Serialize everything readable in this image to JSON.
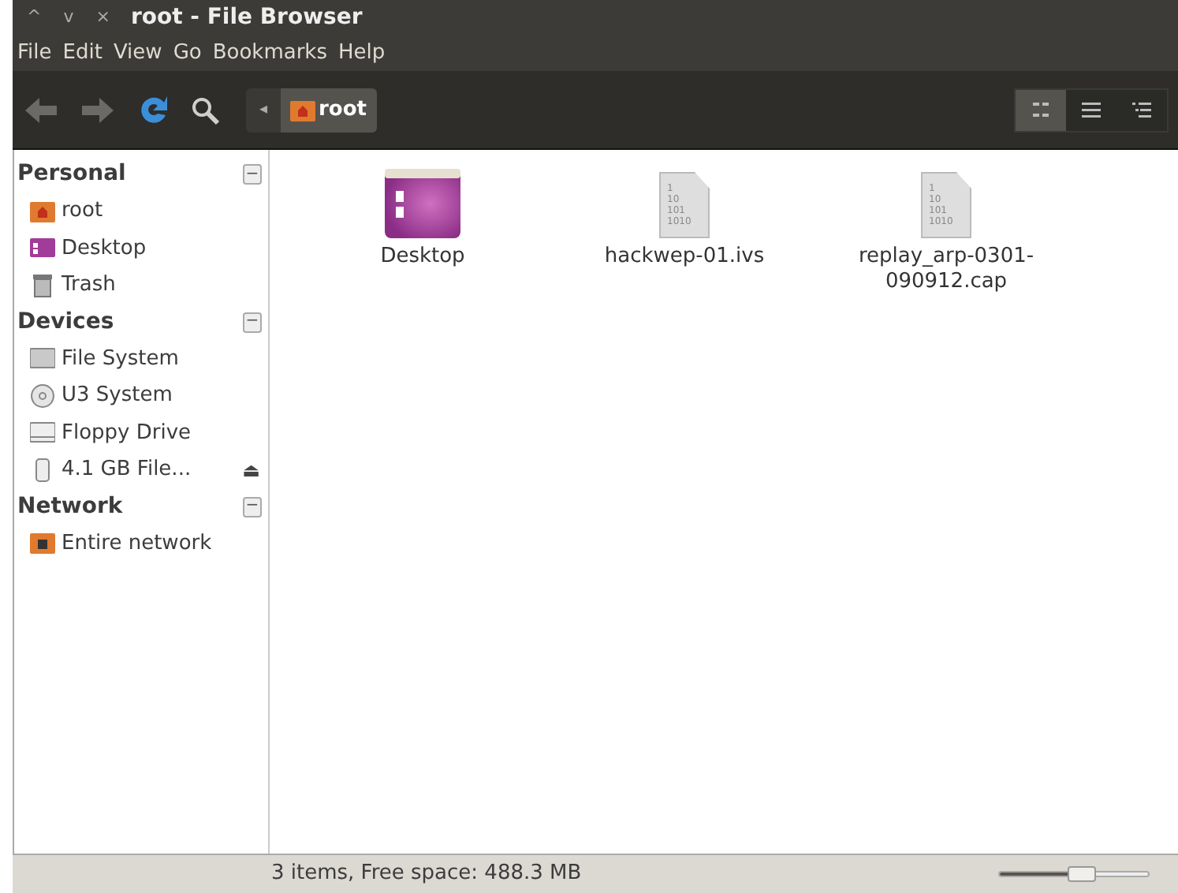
{
  "window": {
    "title": "root - File Browser",
    "controls": [
      "^",
      "v",
      "×"
    ]
  },
  "menu": [
    "File",
    "Edit",
    "View",
    "Go",
    "Bookmarks",
    "Help"
  ],
  "toolbar": {
    "tools": [
      {
        "kind": "back",
        "disabled": true
      },
      {
        "kind": "forward",
        "disabled": true
      },
      {
        "kind": "reload",
        "disabled": false
      },
      {
        "kind": "search",
        "disabled": false
      }
    ],
    "path_arrow": "◂",
    "path": "root",
    "views": [
      {
        "kind": "icons",
        "selected": true
      },
      {
        "kind": "list",
        "selected": false
      },
      {
        "kind": "compact",
        "selected": false
      }
    ]
  },
  "sidebar": [
    {
      "title": "Personal",
      "collapse": "−",
      "items": [
        {
          "kind": "home",
          "label": "root"
        },
        {
          "kind": "desktop",
          "label": "Desktop"
        },
        {
          "kind": "trash",
          "label": "Trash"
        }
      ]
    },
    {
      "title": "Devices",
      "collapse": "−",
      "items": [
        {
          "kind": "disk",
          "label": "File System"
        },
        {
          "kind": "cd",
          "label": "U3 System"
        },
        {
          "kind": "floppy",
          "label": "Floppy Drive"
        },
        {
          "kind": "usb",
          "label": "4.1 GB File...",
          "eject": "⏏"
        }
      ]
    },
    {
      "title": "Network",
      "collapse": "−",
      "items": [
        {
          "kind": "network",
          "label": "Entire network"
        }
      ]
    }
  ],
  "files": [
    {
      "kind": "folder",
      "name": "Desktop"
    },
    {
      "kind": "binary",
      "name": "hackwep-01.ivs",
      "icon_lines": [
        "1",
        "10",
        "101",
        "1010"
      ]
    },
    {
      "kind": "binary",
      "name": "replay_arp-0301-090912.cap",
      "icon_lines": [
        "1",
        "10",
        "101",
        "1010"
      ]
    }
  ],
  "status_bar": {
    "text": "3 items, Free space: 488.3 MB",
    "zoom": {
      "level": 0.55
    }
  }
}
